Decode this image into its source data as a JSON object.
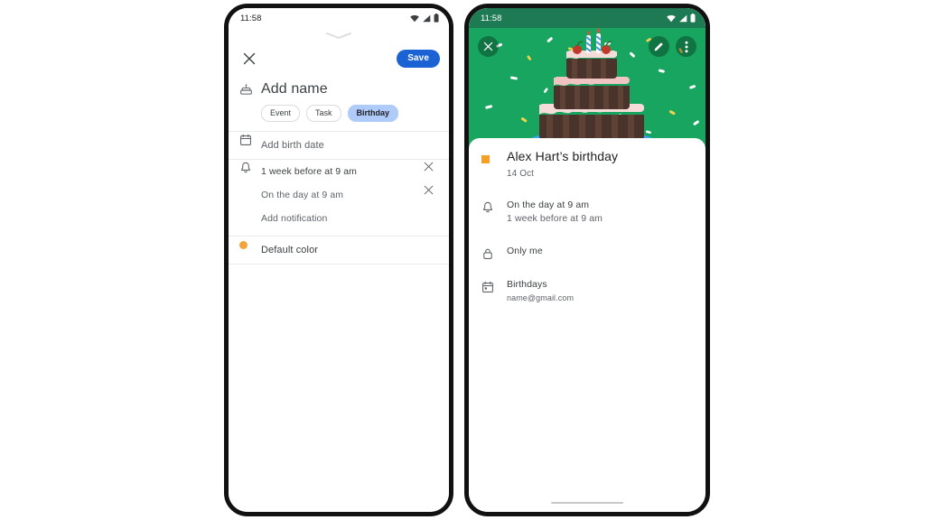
{
  "left_phone": {
    "status_bar": {
      "time": "11:58",
      "icons": [
        "wifi-icon",
        "signal-icon",
        "battery-icon"
      ]
    },
    "sheet": {
      "handle": "chevron-down-handle",
      "close_label": "✕",
      "save_label": "Save",
      "name_field": {
        "icon": "cake-icon",
        "placeholder": "Add name",
        "value": ""
      },
      "type_chips": [
        {
          "label": "Event",
          "selected": false
        },
        {
          "label": "Task",
          "selected": false
        },
        {
          "label": "Birthday",
          "selected": true
        }
      ],
      "date_field": {
        "icon": "calendar-icon",
        "placeholder": "Add birth date",
        "value": ""
      },
      "notifications": {
        "icon": "bell-icon",
        "items": [
          {
            "label": "1 week before at 9 am",
            "remove_label": "✕"
          },
          {
            "label": "On the day at 9 am",
            "remove_label": "✕"
          }
        ],
        "add_label": "Add notification"
      },
      "color_field": {
        "icon": "color-dot",
        "label": "Default color",
        "color": "#f2a33c"
      }
    }
  },
  "right_phone": {
    "status_bar": {
      "time": "11:58",
      "icons": [
        "wifi-icon",
        "signal-icon",
        "battery-icon"
      ]
    },
    "hero": {
      "background_color": "#18a55f",
      "status_color": "#1d7a53",
      "illustration": "birthday-cake-illustration",
      "close_label": "✕",
      "edit_icon": "pencil-icon",
      "more_icon": "more-vert-icon"
    },
    "details": {
      "color_swatch": "#f4a026",
      "title": "Alex Hart’s birthday",
      "date": "14 Oct",
      "notifications": {
        "icon": "bell-icon",
        "line1": "On the day at 9 am",
        "line2": "1 week before at 9 am"
      },
      "visibility": {
        "icon": "lock-icon",
        "label": "Only me"
      },
      "calendar": {
        "icon": "calendar-icon",
        "name": "Birthdays",
        "account": "name@gmail.com"
      }
    },
    "gesture_bar": "gesture-bar"
  }
}
